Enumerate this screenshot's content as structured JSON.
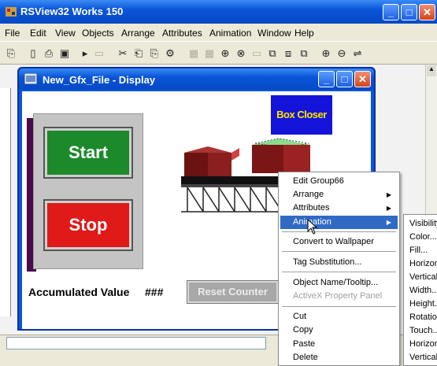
{
  "app": {
    "title": "RSView32 Works 150"
  },
  "menubar": {
    "items": [
      "File",
      "Edit",
      "View",
      "Objects",
      "Arrange",
      "Attributes",
      "Animation",
      "Window",
      "Help"
    ]
  },
  "toolbar": {
    "icons": [
      "select-icon",
      "new-icon",
      "open-icon",
      "save-icon",
      "cut-icon",
      "copy-icon",
      "paste-icon",
      "find-icon",
      "zoom-in-icon",
      "zoom-out-icon"
    ]
  },
  "display_window": {
    "title": "New_Gfx_File - Display"
  },
  "display": {
    "start_label": "Start",
    "stop_label": "Stop",
    "accumulated_label": "Accumulated Value",
    "accumulated_value": "###",
    "reset_label": "Reset Counter",
    "box_closer_label": "Box Closer"
  },
  "context_menu": {
    "items": [
      {
        "label": "Edit Group66"
      },
      {
        "label": "Arrange",
        "submenu": true
      },
      {
        "label": "Attributes",
        "submenu": true
      },
      {
        "label": "Animation",
        "submenu": true,
        "selected": true
      },
      {
        "label": "Convert to Wallpaper"
      },
      {
        "label": "Tag Substitution..."
      },
      {
        "label": "Object Name/Tooltip..."
      },
      {
        "label": "ActiveX Property Panel",
        "disabled": true
      },
      {
        "label": "Cut"
      },
      {
        "label": "Copy"
      },
      {
        "label": "Paste"
      },
      {
        "label": "Delete"
      }
    ]
  },
  "animation_submenu": {
    "items": [
      "Visibility",
      "Color...",
      "Fill...",
      "Horizon",
      "Vertical",
      "Width...",
      "Height...",
      "Rotation",
      "Touch...",
      "Horizon",
      "Vertical"
    ]
  },
  "colors": {
    "titlebar": "#0a55d8",
    "start": "#1c8a2a",
    "stop": "#e01919",
    "box_closer_bg": "#1313d9",
    "box_closer_text": "#ffe400",
    "menu_highlight": "#316ac5"
  }
}
